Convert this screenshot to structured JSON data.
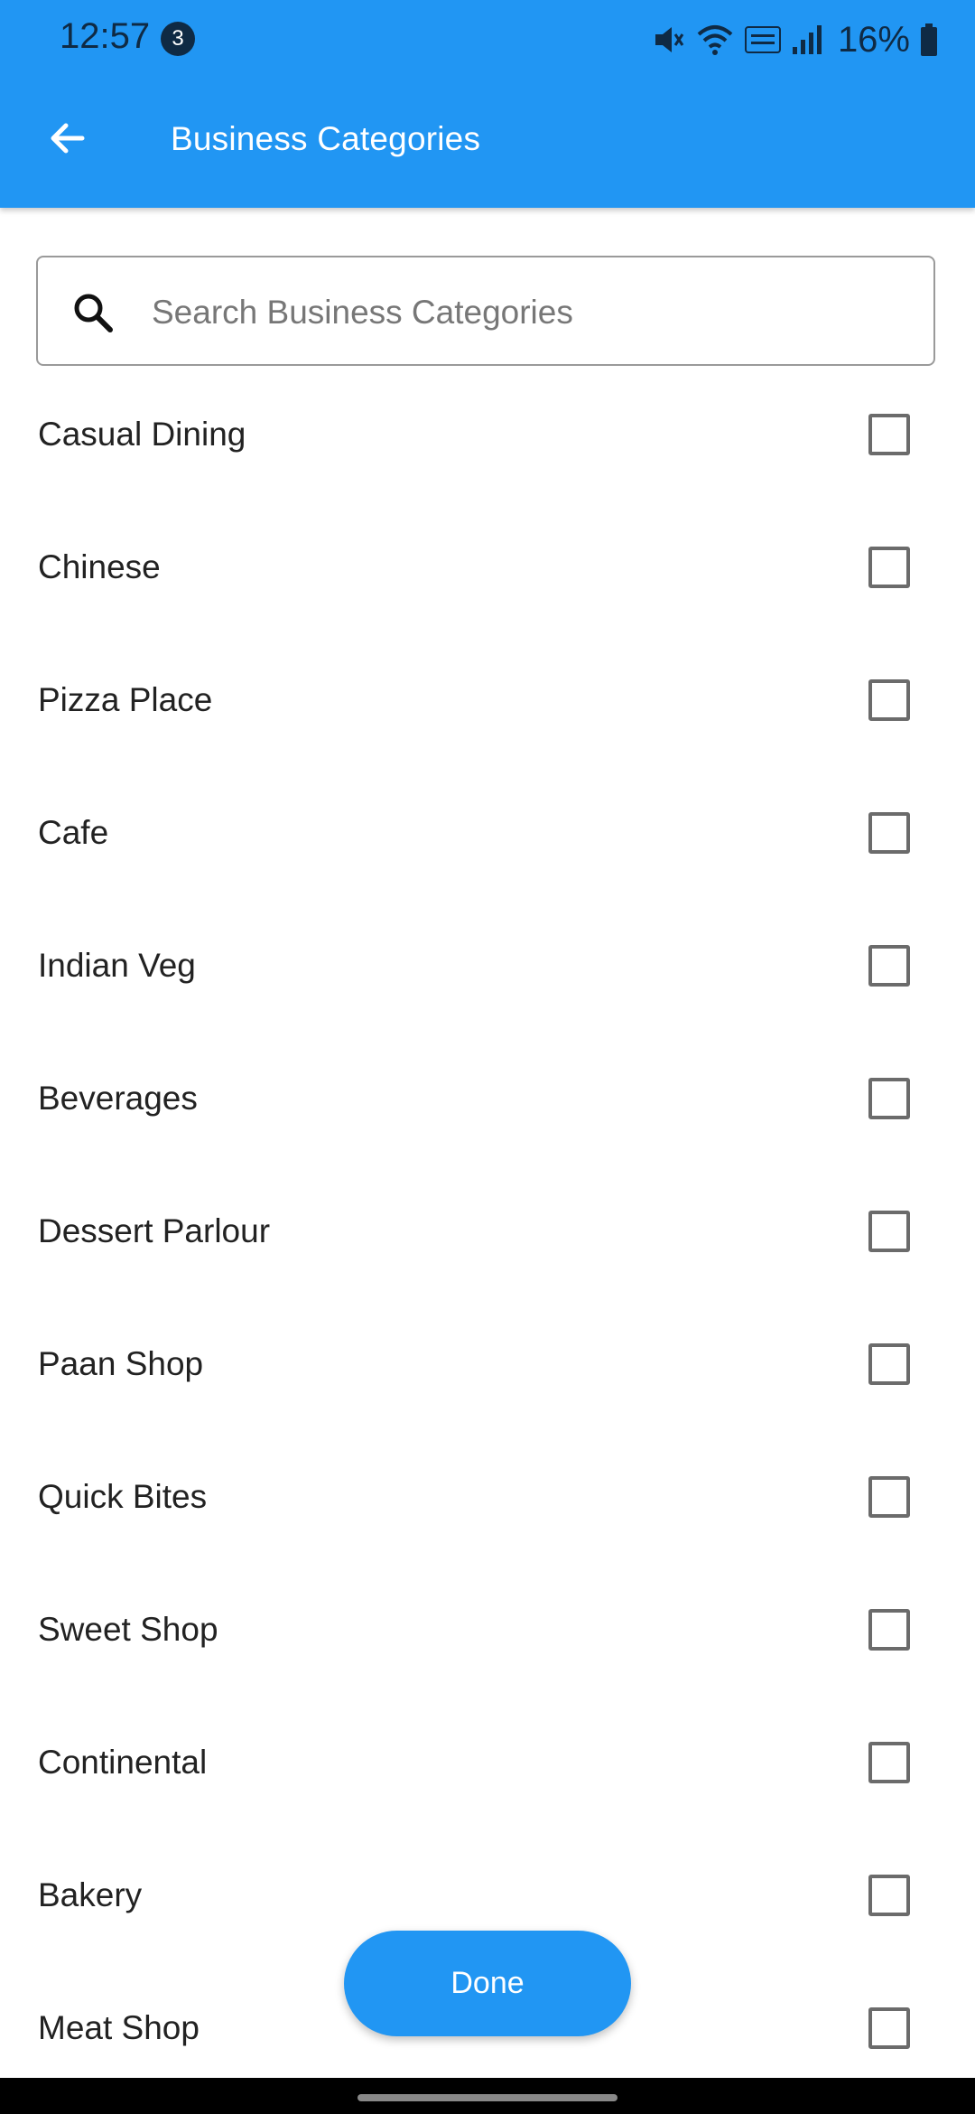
{
  "status_bar": {
    "time": "12:57",
    "notification_count": "3",
    "battery": "16%"
  },
  "app_bar": {
    "title": "Business Categories"
  },
  "search": {
    "placeholder": "Search Business Categories",
    "value": ""
  },
  "categories": [
    {
      "label": "Casual Dining",
      "checked": false
    },
    {
      "label": "Chinese",
      "checked": false
    },
    {
      "label": "Pizza Place",
      "checked": false
    },
    {
      "label": "Cafe",
      "checked": false
    },
    {
      "label": "Indian Veg",
      "checked": false
    },
    {
      "label": "Beverages",
      "checked": false
    },
    {
      "label": "Dessert Parlour",
      "checked": false
    },
    {
      "label": "Paan Shop",
      "checked": false
    },
    {
      "label": "Quick Bites",
      "checked": false
    },
    {
      "label": "Sweet Shop",
      "checked": false
    },
    {
      "label": "Continental",
      "checked": false
    },
    {
      "label": "Bakery",
      "checked": false
    },
    {
      "label": "Meat Shop",
      "checked": false
    }
  ],
  "done_button": {
    "label": "Done"
  },
  "colors": {
    "primary": "#2196F3",
    "status_text": "#0f2a44",
    "checkbox_border": "#6b6b6b"
  }
}
